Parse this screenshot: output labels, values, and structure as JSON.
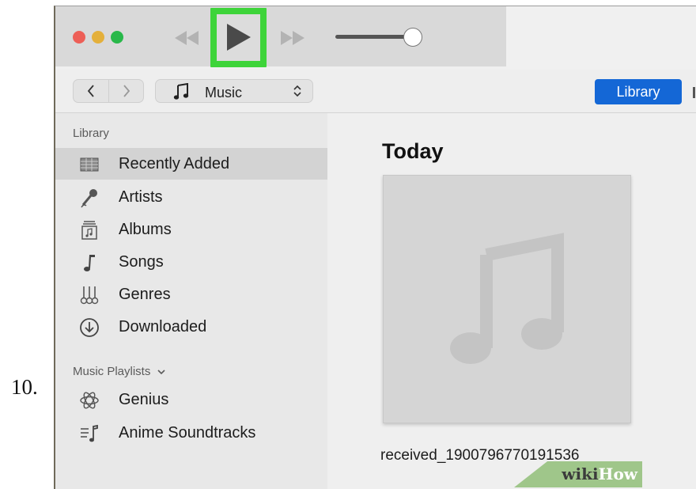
{
  "step_number": "10.",
  "toolbar": {
    "media_type": "Music",
    "library_button": "Library"
  },
  "sidebar": {
    "library_header": "Library",
    "library_items": [
      {
        "label": "Recently Added",
        "icon": "recently-added-icon",
        "selected": true
      },
      {
        "label": "Artists",
        "icon": "microphone-icon"
      },
      {
        "label": "Albums",
        "icon": "albums-icon"
      },
      {
        "label": "Songs",
        "icon": "music-note-icon"
      },
      {
        "label": "Genres",
        "icon": "guitars-icon"
      },
      {
        "label": "Downloaded",
        "icon": "download-circle-icon"
      }
    ],
    "playlists_header": "Music Playlists",
    "playlist_items": [
      {
        "label": "Genius",
        "icon": "genius-atom-icon"
      },
      {
        "label": "Anime Soundtracks",
        "icon": "playlist-icon"
      }
    ]
  },
  "main": {
    "heading": "Today",
    "album_title": "received_1900796770191536"
  },
  "watermark": {
    "part1": "wiki",
    "part2": "How"
  },
  "colors": {
    "play_highlight": "#3ed43a",
    "library_button": "#1467d6",
    "traffic_red": "#ed5f57",
    "traffic_yellow": "#e4b03b",
    "traffic_green": "#29b84a"
  }
}
